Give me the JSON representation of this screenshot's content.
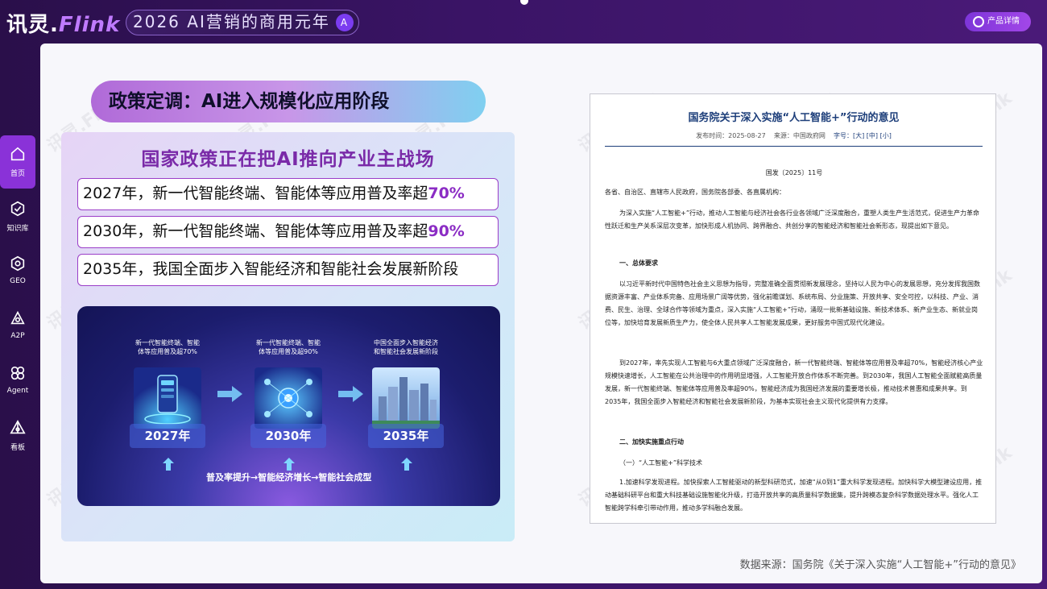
{
  "header": {
    "logo_cn": "讯灵.",
    "logo_brand": "Flink",
    "title": "2026 AI营销的商用元年",
    "title_icon": "A",
    "product_label": "产品详情"
  },
  "sidebar": {
    "items": [
      {
        "label": "首页",
        "icon": "home-icon",
        "active": true
      },
      {
        "label": "知识库",
        "icon": "knowledge-icon",
        "active": false
      },
      {
        "label": "GEO",
        "icon": "geo-icon",
        "active": false
      },
      {
        "label": "A2P",
        "icon": "a2p-icon",
        "active": false
      },
      {
        "label": "Agent",
        "icon": "agent-icon",
        "active": false
      },
      {
        "label": "看板",
        "icon": "dashboard-icon",
        "active": false
      }
    ]
  },
  "watermark": "讯灵.Flink",
  "left": {
    "heading": "政策定调：AI进入规模化应用阶段",
    "subheading": "国家政策正在把AI推向产业主战场",
    "goals": [
      {
        "text": "2027年，新一代智能终端、智能体等应用普及率超",
        "pct": "70%"
      },
      {
        "text": "2030年，新一代智能终端、智能体等应用普及率超",
        "pct": "90%"
      },
      {
        "text": "2035年，我国全面步入智能经济和智能社会发展新阶段",
        "pct": ""
      }
    ],
    "roadmap": {
      "stages": [
        {
          "desc": "新一代智能终端、智能体等应用普及超70%",
          "year": "2027年"
        },
        {
          "desc": "新一代智能终端、智能体等应用普及超90%",
          "year": "2030年"
        },
        {
          "desc": "中国全面步入智能经济和智能社会发展新阶段",
          "year": "2035年"
        }
      ],
      "footer": "普及率提升→智能经济增长→智能社会成型"
    }
  },
  "doc": {
    "title": "国务院关于深入实施“人工智能+”行动的意见",
    "meta_date": "发布时间：2025-08-27",
    "meta_source": "来源：中国政府网",
    "meta_size": "字号：[大] [中] [小]",
    "doc_no": "国发〔2025〕11号",
    "addressee": "各省、自治区、直辖市人民政府，国务院各部委、各直属机构：",
    "p1": "为深入实施“人工智能+”行动，推动人工智能与经济社会各行业各领域广泛深度融合，重塑人类生产生活范式，促进生产力革命性跃迁和生产关系深层次变革，加快形成人机协同、跨界融合、共创分享的智能经济和智能社会新形态，现提出如下意见。",
    "h1": "一、总体要求",
    "p2": "以习近平新时代中国特色社会主义思想为指导，完整准确全面贯彻新发展理念，坚持以人民为中心的发展思想，充分发挥我国数据资源丰富、产业体系完备、应用场景广阔等优势，强化前瞻谋划、系统布局、分业施策、开放共享、安全可控，以科技、产业、消费、民生、治理、全球合作等领域为重点，深入实施“人工智能+”行动，涌现一批新基础设施、新技术体系、新产业生态、新就业岗位等，加快培育发展新质生产力，使全体人民共享人工智能发展成果，更好服务中国式现代化建设。",
    "p3": "到2027年，率先实现人工智能与6大重点领域广泛深度融合，新一代智能终端、智能体等应用普及率超70%，智能经济核心产业规模快速增长，人工智能在公共治理中的作用明显增强，人工智能开放合作体系不断完善。到2030年，我国人工智能全面赋能高质量发展，新一代智能终端、智能体等应用普及率超90%，智能经济成为我国经济发展的重要增长极，推动技术普惠和成果共享。到2035年，我国全面步入智能经济和智能社会发展新阶段，为基本实现社会主义现代化提供有力支撑。",
    "h2": "二、加快实施重点行动",
    "h2_1": "（一）“人工智能+”科学技术",
    "p4": "1.加速科学发现进程。加快探索人工智能驱动的新型科研范式，加速“从0到1”重大科学发现进程。加快科学大模型建设应用，推动基础科研平台和重大科技基础设施智能化升级，打造开放共享的高质量科学数据集，提升跨模态复杂科学数据处理水平。强化人工智能跨学科牵引带动作用，推动多学科融合发展。"
  },
  "source": "数据来源：国务院《关于深入实施“人工智能+”行动的意见》",
  "colors": {
    "accent": "#8b2cc4",
    "doc_title": "#1d3e7a",
    "panel": "#f7f7fb"
  }
}
